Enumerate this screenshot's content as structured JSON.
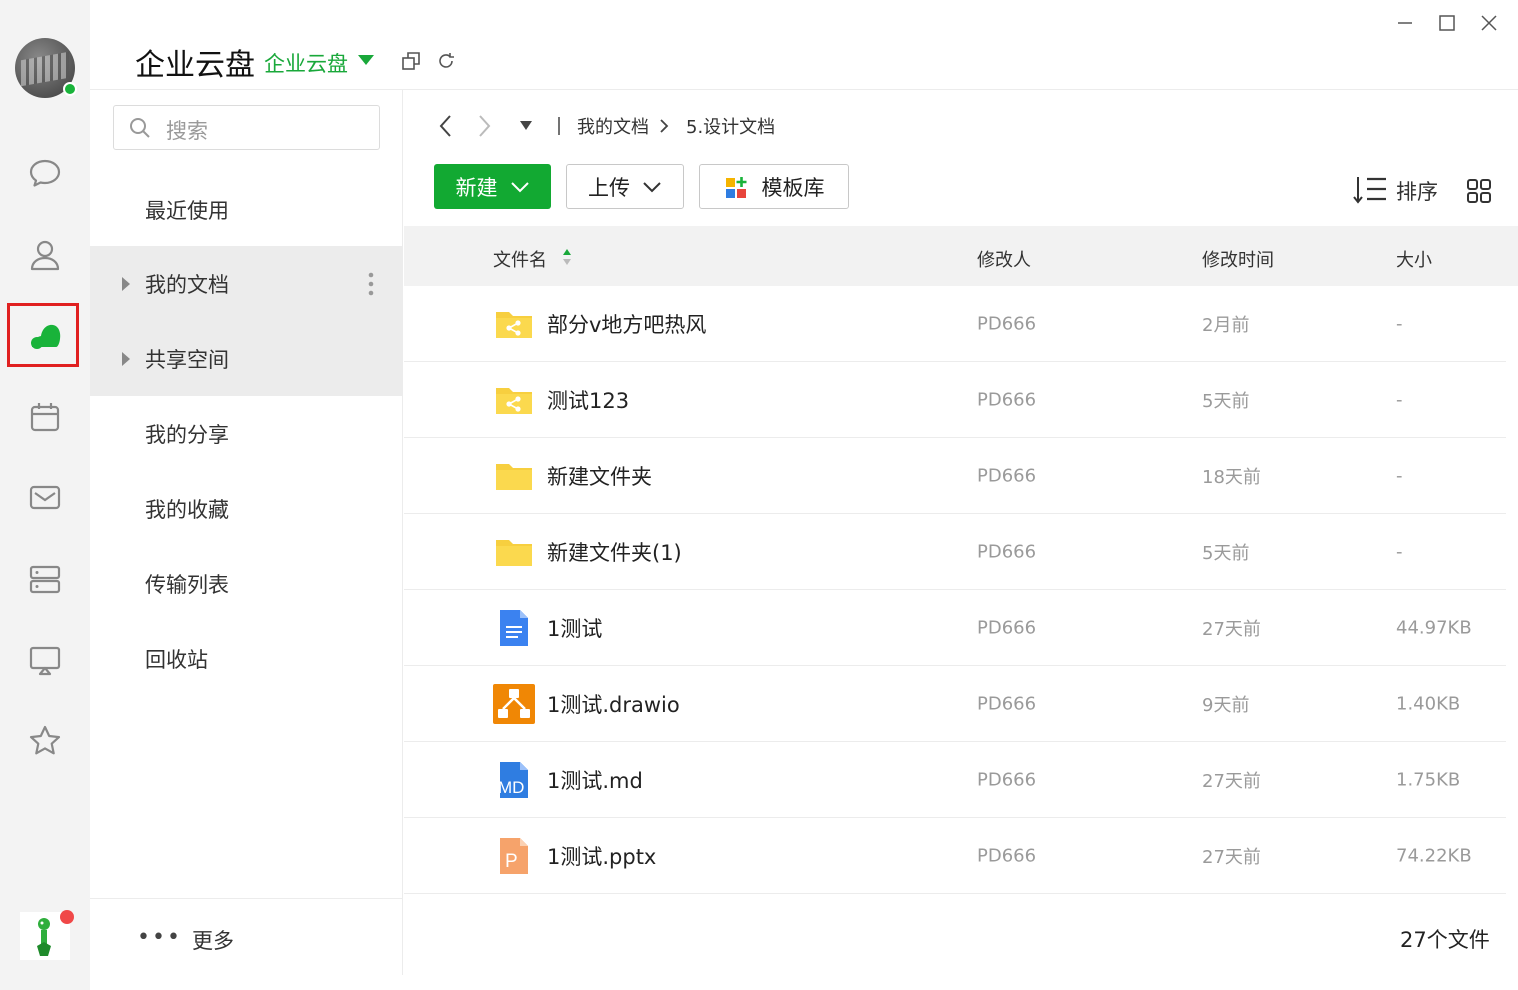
{
  "window": {
    "title": "企业云盘",
    "space_switch": "企业云盘",
    "controls": [
      "minimize",
      "maximize",
      "close"
    ]
  },
  "rail": {
    "items": [
      "chat-icon",
      "contacts-icon",
      "cloud-disk-icon",
      "calendar-icon",
      "mail-icon",
      "server-icon",
      "screen-share-icon",
      "favorite-icon"
    ],
    "active": "cloud-disk-icon",
    "accent": "#19b33a"
  },
  "sidebar": {
    "search_placeholder": "搜索",
    "items": [
      {
        "label": "最近使用"
      },
      {
        "label": "我的文档"
      },
      {
        "label": "共享空间"
      },
      {
        "label": "我的分享"
      },
      {
        "label": "我的收藏"
      },
      {
        "label": "传输列表"
      },
      {
        "label": "回收站"
      }
    ],
    "more_label": "更多"
  },
  "breadcrumb": {
    "items": [
      "我的文档",
      "5.设计文档"
    ]
  },
  "toolbar": {
    "new_label": "新建",
    "upload_label": "上传",
    "template_label": "模板库",
    "sort_label": "排序"
  },
  "table": {
    "headers": {
      "name": "文件名",
      "modifier": "修改人",
      "time": "修改时间",
      "size": "大小"
    },
    "rows": [
      {
        "name": "部分v地方吧热风",
        "modifier": "PD666",
        "time": "2月前",
        "size": "-",
        "icon": "shared-folder-icon"
      },
      {
        "name": "测试123",
        "modifier": "PD666",
        "time": "5天前",
        "size": "-",
        "icon": "shared-folder-icon"
      },
      {
        "name": "新建文件夹",
        "modifier": "PD666",
        "time": "18天前",
        "size": "-",
        "icon": "folder-icon"
      },
      {
        "name": "新建文件夹(1)",
        "modifier": "PD666",
        "time": "5天前",
        "size": "-",
        "icon": "folder-icon"
      },
      {
        "name": "1测试",
        "modifier": "PD666",
        "time": "27天前",
        "size": "44.97KB",
        "icon": "doc-file-icon"
      },
      {
        "name": "1测试.drawio",
        "modifier": "PD666",
        "time": "9天前",
        "size": "1.40KB",
        "icon": "drawio-file-icon"
      },
      {
        "name": "1测试.md",
        "modifier": "PD666",
        "time": "27天前",
        "size": "1.75KB",
        "icon": "md-file-icon",
        "icon_text": "MD"
      },
      {
        "name": "1测试.pptx",
        "modifier": "PD666",
        "time": "27天前",
        "size": "74.22KB",
        "icon": "pptx-file-icon",
        "icon_text": "P"
      }
    ]
  },
  "footer": {
    "count": "27个文件"
  }
}
